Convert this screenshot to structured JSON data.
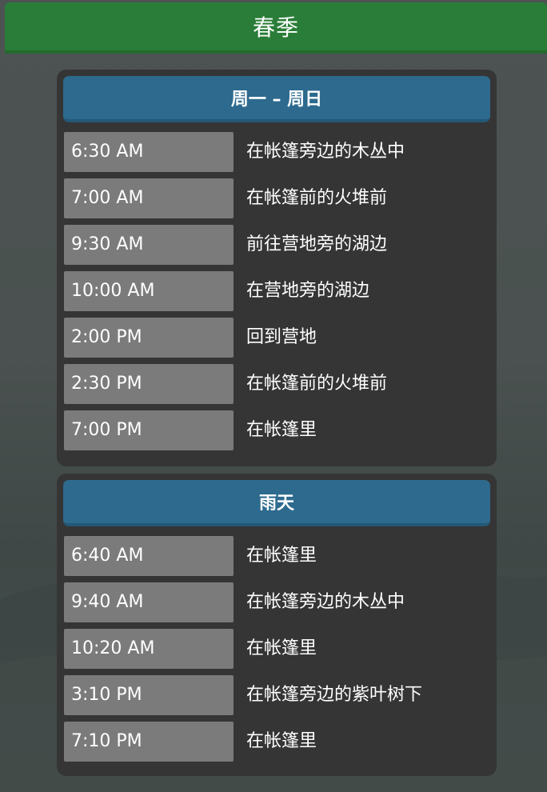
{
  "season": {
    "title": "春季"
  },
  "colors": {
    "season_header": "#2a7d38",
    "section_header": "#2d6a8e",
    "panel": "#353535",
    "time_box": "#7b7b7b",
    "text": "#ffffff"
  },
  "schedules": [
    {
      "title": "周一 – 周日",
      "entries": [
        {
          "time": "6:30 AM",
          "description": "在帐篷旁边的木丛中"
        },
        {
          "time": "7:00 AM",
          "description": "在帐篷前的火堆前"
        },
        {
          "time": "9:30 AM",
          "description": "前往营地旁的湖边"
        },
        {
          "time": "10:00 AM",
          "description": "在营地旁的湖边"
        },
        {
          "time": "2:00 PM",
          "description": "回到营地"
        },
        {
          "time": "2:30 PM",
          "description": "在帐篷前的火堆前"
        },
        {
          "time": "7:00 PM",
          "description": "在帐篷里"
        }
      ]
    },
    {
      "title": "雨天",
      "entries": [
        {
          "time": "6:40 AM",
          "description": "在帐篷里"
        },
        {
          "time": "9:40 AM",
          "description": "在帐篷旁边的木丛中"
        },
        {
          "time": "10:20 AM",
          "description": "在帐篷里"
        },
        {
          "time": "3:10 PM",
          "description": "在帐篷旁边的紫叶树下"
        },
        {
          "time": "7:10 PM",
          "description": "在帐篷里"
        }
      ]
    }
  ]
}
